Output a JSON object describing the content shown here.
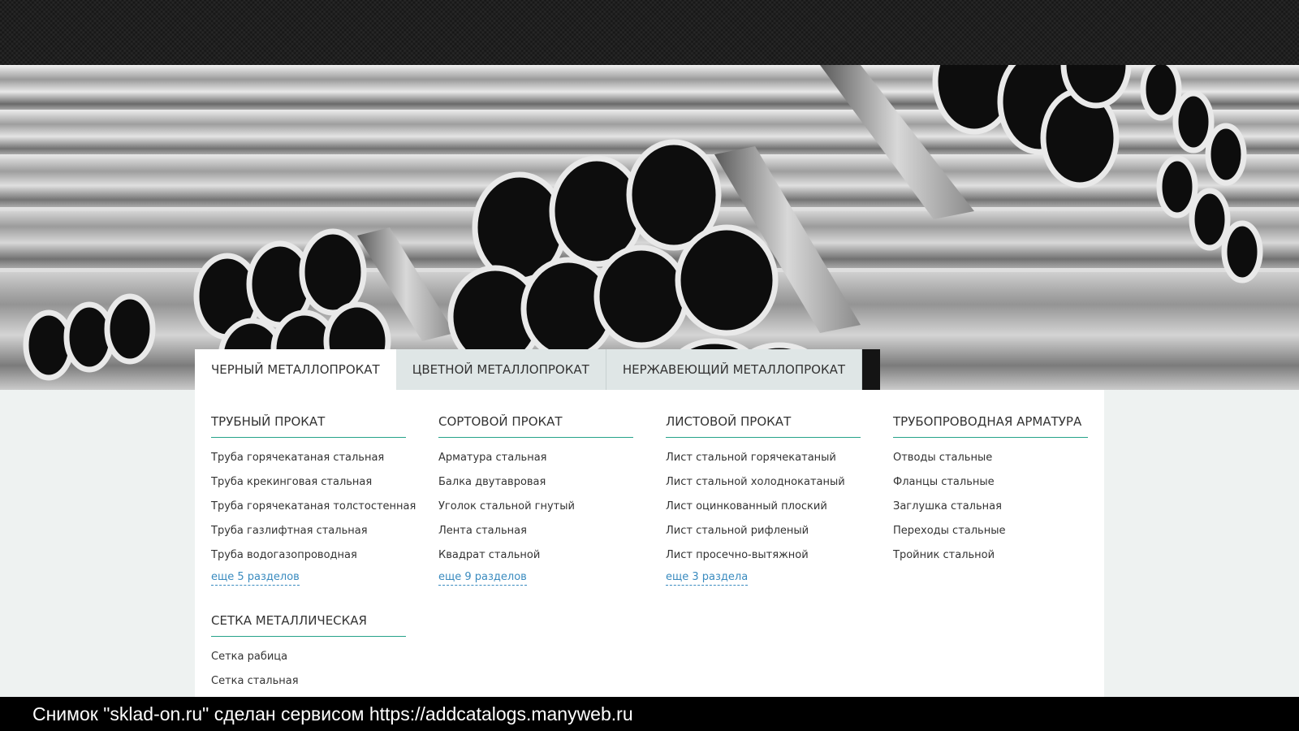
{
  "tabs": [
    {
      "label": "ЧЕРНЫЙ МЕТАЛЛОПРОКАТ",
      "active": true
    },
    {
      "label": "ЦВЕТНОЙ МЕТАЛЛОПРОКАТ",
      "active": false
    },
    {
      "label": "НЕРЖАВЕЮЩИЙ МЕТАЛЛОПРОКАТ",
      "active": false
    }
  ],
  "columns": {
    "pipe": {
      "title": "ТРУБНЫЙ ПРОКАТ",
      "items": [
        "Труба горячекатаная стальная",
        "Труба крекинговая стальная",
        "Труба горячекатаная толстостенная",
        "Труба газлифтная стальная",
        "Труба водогазопроводная"
      ],
      "more": "еще 5 разделов"
    },
    "section": {
      "title": "СОРТОВОЙ ПРОКАТ",
      "items": [
        "Арматура стальная",
        "Балка двутавровая",
        "Уголок стальной гнутый",
        "Лента стальная",
        "Квадрат стальной"
      ],
      "more": "еще 9 разделов"
    },
    "sheet": {
      "title": "ЛИСТОВОЙ ПРОКАТ",
      "items": [
        "Лист стальной горячекатаный",
        "Лист стальной холоднокатаный",
        "Лист оцинкованный плоский",
        "Лист стальной рифленый",
        "Лист просечно-вытяжной"
      ],
      "more": "еще 3 раздела"
    },
    "fittings": {
      "title": "ТРУБОПРОВОДНАЯ АРМАТУРА",
      "items": [
        "Отводы стальные",
        "Фланцы стальные",
        "Заглушка стальная",
        "Переходы стальные",
        "Тройник стальной"
      ]
    },
    "mesh": {
      "title": "СЕТКА МЕТАЛЛИЧЕСКАЯ",
      "items": [
        "Сетка рабица",
        "Сетка стальная"
      ]
    }
  },
  "caption": "Снимок \"sklad-on.ru\" сделан сервисом https://addcatalogs.manyweb.ru",
  "colors": {
    "accent_line": "#26a38a",
    "link": "#3a8bbf",
    "tab_inactive": "#dfe6e6",
    "page_bg": "#eef2f1"
  }
}
